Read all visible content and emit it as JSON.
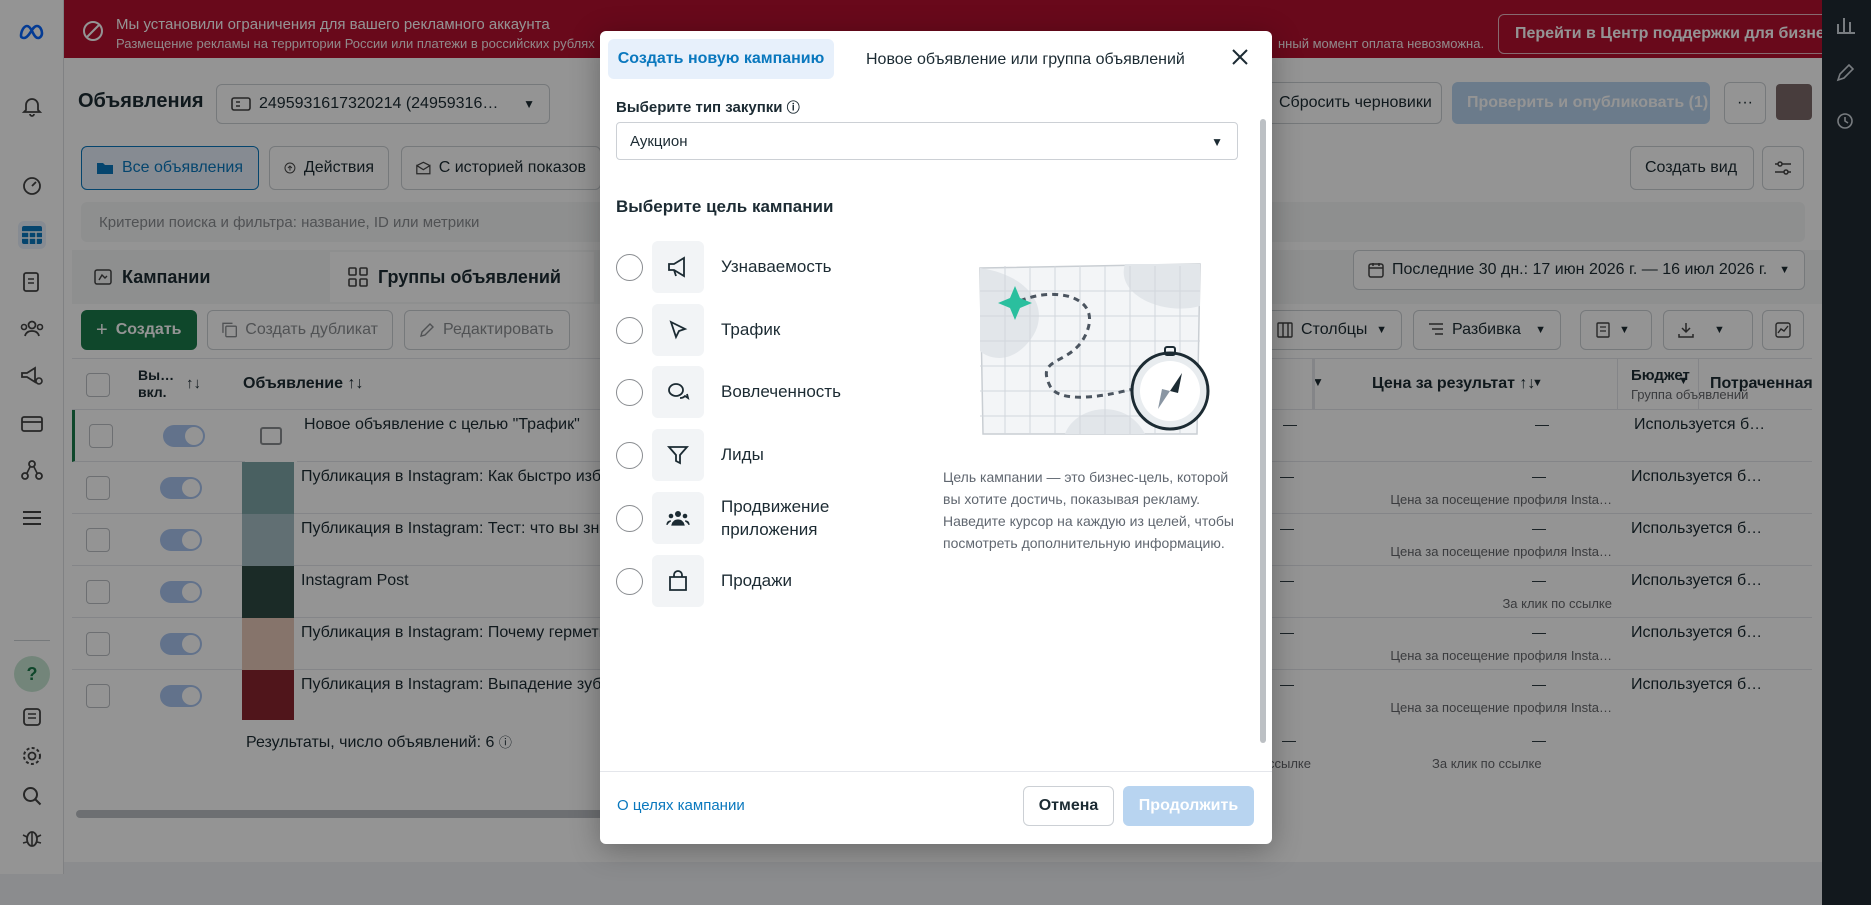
{
  "banner": {
    "title": "Мы установили ограничения для вашего рекламного аккаунта",
    "text": "Размещение рекламы на территории России или платежи в российских рублях",
    "text_right": "нный момент оплата невозможна.",
    "support_button": "Перейти в Центр поддержки для бизнеса"
  },
  "header": {
    "title": "Объявления",
    "account": "2495931617320214 (24959316…",
    "discard_drafts": "Сбросить черновики",
    "review_publish": "Проверить и опубликовать (1)",
    "more": "···"
  },
  "toolbar": {
    "all_ads": "Все объявления",
    "actions": "Действия",
    "with_history": "С историей показов",
    "create_view": "Создать вид",
    "search_placeholder": "Критерии поиска и фильтра: название, ID или метрики",
    "date_range": "Последние 30 дн.: 17 июн 2026 г. — 16 июл 2026 г.",
    "create": "Создать",
    "duplicate": "Создать дубликат",
    "edit": "Редактировать",
    "columns": "Столбцы",
    "breakdown": "Разбивка"
  },
  "tabs": {
    "campaigns": "Кампании",
    "adsets": "Группы объявлений"
  },
  "table": {
    "col_onoff": "Вы… вкл.",
    "col_ad": "Объявление",
    "col_cost": "Цена за результат",
    "col_budget": "Бюджет",
    "col_budget_sub": "Группа объявлений",
    "col_spent": "Потраченная",
    "rows": [
      {
        "name": "Новое объявление с целью \"Трафик\"",
        "dash": "—",
        "cost": "—",
        "cost_sub": "",
        "budget": "Используется б…"
      },
      {
        "name": "Публикация в Instagram: Как быстро изба",
        "dash": "—",
        "cost": "—",
        "cost_sub": "Цена за посещение профиля Insta…",
        "budget": "Используется б…"
      },
      {
        "name": "Публикация в Instagram: Тест: что вы знае",
        "dash": "—",
        "cost": "—",
        "cost_sub": "Цена за посещение профиля Insta…",
        "budget": "Используется б…"
      },
      {
        "name": "Instagram Post",
        "dash": "—",
        "cost": "—",
        "cost_sub": "За клик по ссылке",
        "budget": "Используется б…"
      },
      {
        "name": "Публикация в Instagram: Почему гермети",
        "dash": "—",
        "cost": "—",
        "cost_sub": "Цена за посещение профиля Insta…",
        "budget": "Используется б…"
      },
      {
        "name": "Публикация в Instagram: Выпадение зубо",
        "dash": "—",
        "cost": "—",
        "cost_sub": "Цена за посещение профиля Insta…",
        "budget": "Используется б…"
      }
    ],
    "summary": "Результаты, число объявлений: 6",
    "summary_cost": "—",
    "summary_cost_sub": "За клик по ссылке",
    "summary_left": "—",
    "summary_left_sub": "ссылке"
  },
  "modal": {
    "tab_new_campaign": "Создать новую кампанию",
    "tab_new_ad": "Новое объявление или группа объявлений",
    "buying_type_label": "Выберите тип закупки",
    "buying_type_value": "Аукцион",
    "objective_heading": "Выберите цель кампании",
    "objectives": [
      {
        "label": "Узнаваемость",
        "icon": "megaphone-icon"
      },
      {
        "label": "Трафик",
        "icon": "cursor-icon"
      },
      {
        "label": "Вовлеченность",
        "icon": "chat-bubbles-icon"
      },
      {
        "label": "Лиды",
        "icon": "funnel-icon"
      },
      {
        "label": "Продвижение приложения",
        "icon": "people-icon"
      },
      {
        "label": "Продажи",
        "icon": "shopping-bag-icon"
      }
    ],
    "description": "Цель кампании — это бизнес-цель, которой вы хотите достичь, показывая рекламу. Наведите курсор на каждую из целей, чтобы посмотреть дополнительную информацию.",
    "about_link": "О целях кампании",
    "cancel": "Отмена",
    "continue": "Продолжить"
  },
  "colors": {
    "banner": "#b6102f",
    "accent": "#0a78be",
    "create_green": "#1b7a4a",
    "continue_disabled": "#b8d4f0"
  }
}
